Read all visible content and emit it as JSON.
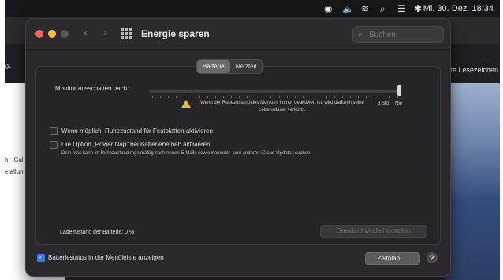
{
  "menubar": {
    "clock": "Mi. 30. Dez.  18:34"
  },
  "background_app": {
    "read_list_label": "ore Lesezeichen",
    "snippet_1": "h - Cal",
    "snippet_2": "etallun",
    "snippet_3": "0-"
  },
  "window": {
    "title": "Energie sparen",
    "search_placeholder": "Suchen"
  },
  "tabs": [
    {
      "label": "Batterie",
      "active": true
    },
    {
      "label": "Netzteil",
      "active": false
    }
  ],
  "slider": {
    "label": "Monitor ausschalten nach:",
    "value_label_1": "3 Std.",
    "value_label_2": "Nie",
    "value": "Nie"
  },
  "warning": {
    "text": "Wenn der Ruhezustand des Monitors immer deaktiviert ist, wird dadurch seine Lebensdauer verkürzt."
  },
  "options": [
    {
      "label": "Wenn möglich, Ruhezustand für Festplatten aktivieren",
      "checked": false
    },
    {
      "label": "Die Option „Power Nap“ bei Batteriebetrieb aktivieren",
      "checked": false,
      "description": "Dein Mac kann im Ruhezustand regelmäßig nach neuen E-Mails sowie Kalender- und anderen iCloud-Updates suchen."
    }
  ],
  "battery_status": "Ladezustand der Batterie: 0 %",
  "restore_button": "Standard wiederherstellen",
  "menubar_option": {
    "label": "Batteriestatus in der Menüleiste anzeigen",
    "checked": true
  },
  "schedule_button": "Zeitplan …",
  "help_button": "?",
  "colors": {
    "accent": "#2f7df6",
    "warning": "#f2b628",
    "window_bg": "#2a282b"
  }
}
